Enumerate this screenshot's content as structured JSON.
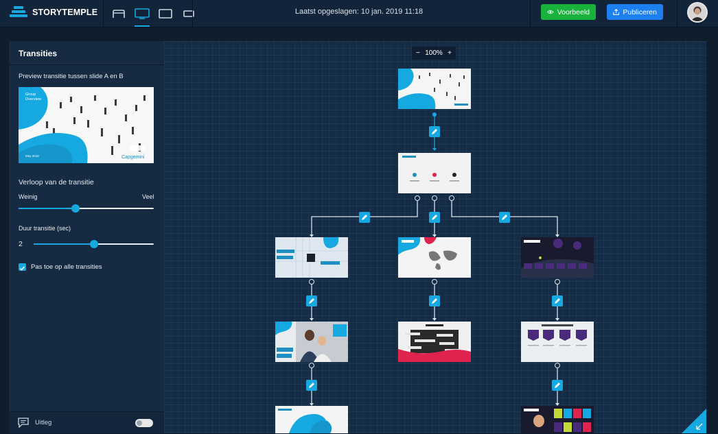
{
  "app": {
    "brand": "STORYTEMPLE",
    "saved_text": "Laatst opgeslagen: 10 jan. 2019 11:18",
    "preview_button": "Voorbeeld",
    "publish_button": "Publiceren",
    "colors": {
      "accent": "#16a8e0",
      "preview": "#19b23d",
      "publish": "#1e7ff0",
      "background": "#0f1d2d"
    }
  },
  "device_options": [
    "tablet-icon",
    "desktop-icon",
    "laptop-icon",
    "mobile-icon"
  ],
  "sidebar": {
    "title": "Transities",
    "preview_label": "Preview transitie tussen slide A en B",
    "preview_slide": {
      "title": "Group Overview",
      "date": "May 2018",
      "logo": "Capgemini"
    },
    "flow_label": "Verloop van de transitie",
    "flow_min": "Weinig",
    "flow_max": "Veel",
    "flow_value": 0.42,
    "duration_label": "Duur transitie (sec)",
    "duration_value": "2",
    "duration_fraction": 0.5,
    "apply_all_label": "Pas toe op alle transities",
    "apply_all_checked": true,
    "footer_label": "Uitleg",
    "footer_toggle_on": false
  },
  "canvas": {
    "zoom": "100%",
    "zoom_out": "−",
    "zoom_in": "+"
  }
}
